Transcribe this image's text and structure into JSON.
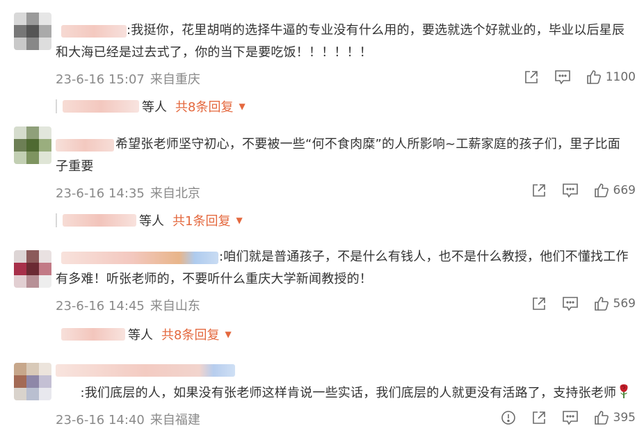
{
  "comments": [
    {
      "text": ":我挺你，花里胡哨的选择牛逼的专业没有什么用的，要选就选个好就业的，毕业以后星辰和大海已经是过去式了，你的当下是要吃饭！！！！！！",
      "date": "23-6-16 15:07",
      "location": "来自重庆",
      "likes": "1100",
      "reply_suffix": "等人",
      "reply_count": "共8条回复",
      "has_report": false
    },
    {
      "text": "希望张老师坚守初心，不要被一些“何不食肉糜”的人所影响~工薪家庭的孩子们，里子比面子重要",
      "date": "23-6-16 14:35",
      "location": "来自北京",
      "likes": "669",
      "reply_suffix": "等人",
      "reply_count": "共1条回复",
      "has_report": false
    },
    {
      "text": ":咱们就是普通孩子，不是什么有钱人，也不是什么教授，他们不懂找工作有多难！听张老师的，不要听什么重庆大学新闻教授的！",
      "date": "23-6-16 14:45",
      "location": "来自山东",
      "likes": "569",
      "reply_suffix": "等人",
      "reply_count": "共8条回复",
      "has_report": false
    },
    {
      "text": ":我们底层的人，如果没有张老师这样肯说一些实话，我们底层的人就更没有活路了，支持张老师",
      "date": "23-6-16 14:40",
      "location": "来自福建",
      "likes": "395",
      "reply_suffix": "",
      "reply_count": "",
      "has_report": true
    }
  ],
  "colors": {
    "accent": "#e4683e",
    "meta": "#8a8a8a",
    "text": "#333333"
  },
  "icons": {
    "share": "share-icon",
    "comment": "comment-icon",
    "like": "thumbs-up-icon",
    "report": "report-icon",
    "caret": "caret-down-icon",
    "emoji": "rose-emoji-icon"
  }
}
